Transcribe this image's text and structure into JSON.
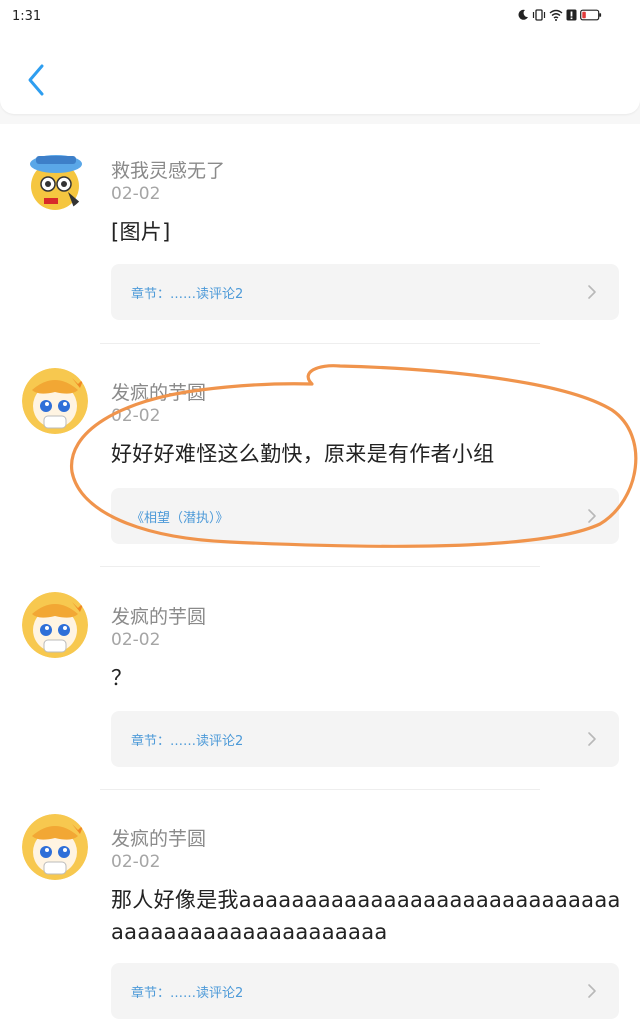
{
  "status_bar": {
    "time": "1:31"
  },
  "header": {
    "back_icon": "chevron-left-icon",
    "accent": "#2e9ef0"
  },
  "comments": [
    {
      "user": "救我灵感无了",
      "date": "02-02",
      "text": "[图片]",
      "chapter": "章节：……读评论2"
    },
    {
      "user": "发疯的芋圆",
      "date": "02-02",
      "text": "好好好难怪这么勤快，原来是有作者小组",
      "chapter": "《相望（潜执）》"
    },
    {
      "user": "发疯的芋圆",
      "date": "02-02",
      "text": "？",
      "chapter": "章节：……读评论2"
    },
    {
      "user": "发疯的芋圆",
      "date": "02-02",
      "text": "那人好像是我aaaaaaaaaaaaaaaaaaaaaaaaaaaaaaaaaaaaaaaaaaaaaaaaaa",
      "chapter": "章节：……读评论2"
    }
  ],
  "colors": {
    "chapter_link": "#4d9ad8",
    "annotation_circle": "#f0944c"
  }
}
